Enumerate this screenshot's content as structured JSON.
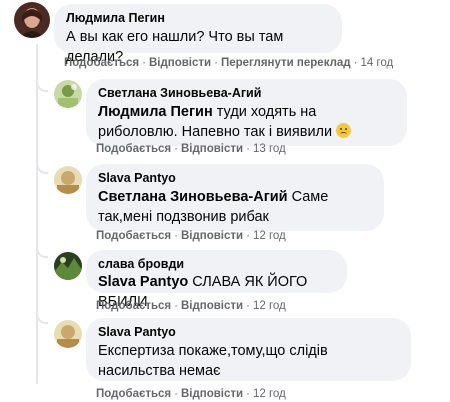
{
  "actions": {
    "like": "Подобається",
    "reply": "Відповісти",
    "translate": "Переглянути переклад",
    "sep": "·"
  },
  "comments": [
    {
      "author": "Людмила Пегин",
      "text": "А вы как его нашли? Что вы там делали?",
      "time": "14 год",
      "avatar_color": "#6b3b2e"
    },
    {
      "author": "Светлана Зиновьева-Агий",
      "mention": "Людмила Пегин",
      "text": " туди ходять на риболовлю. Напевно так і виявили ",
      "emoji": "sad-face-emoji",
      "time": "13 год",
      "avatar_color": "#9ab36a"
    },
    {
      "author": "Slava Pantyo",
      "mention": "Светлана Зиновьева-Агий",
      "text": " Саме так,мені подзвонив рибак",
      "time": "12 год",
      "avatar_color": "#d8c48e"
    },
    {
      "author": "слава бровди",
      "mention": "Slava Pantyo",
      "text": " СЛАВА ЯК ЙОГО ВБИЛИ",
      "time": "12 год",
      "avatar_color": "#3d5a2c"
    },
    {
      "author": "Slava Pantyo",
      "text": "Експертиза покаже,тому,що слідів насильства немає",
      "time": "12 год",
      "avatar_color": "#d8c48e"
    }
  ]
}
